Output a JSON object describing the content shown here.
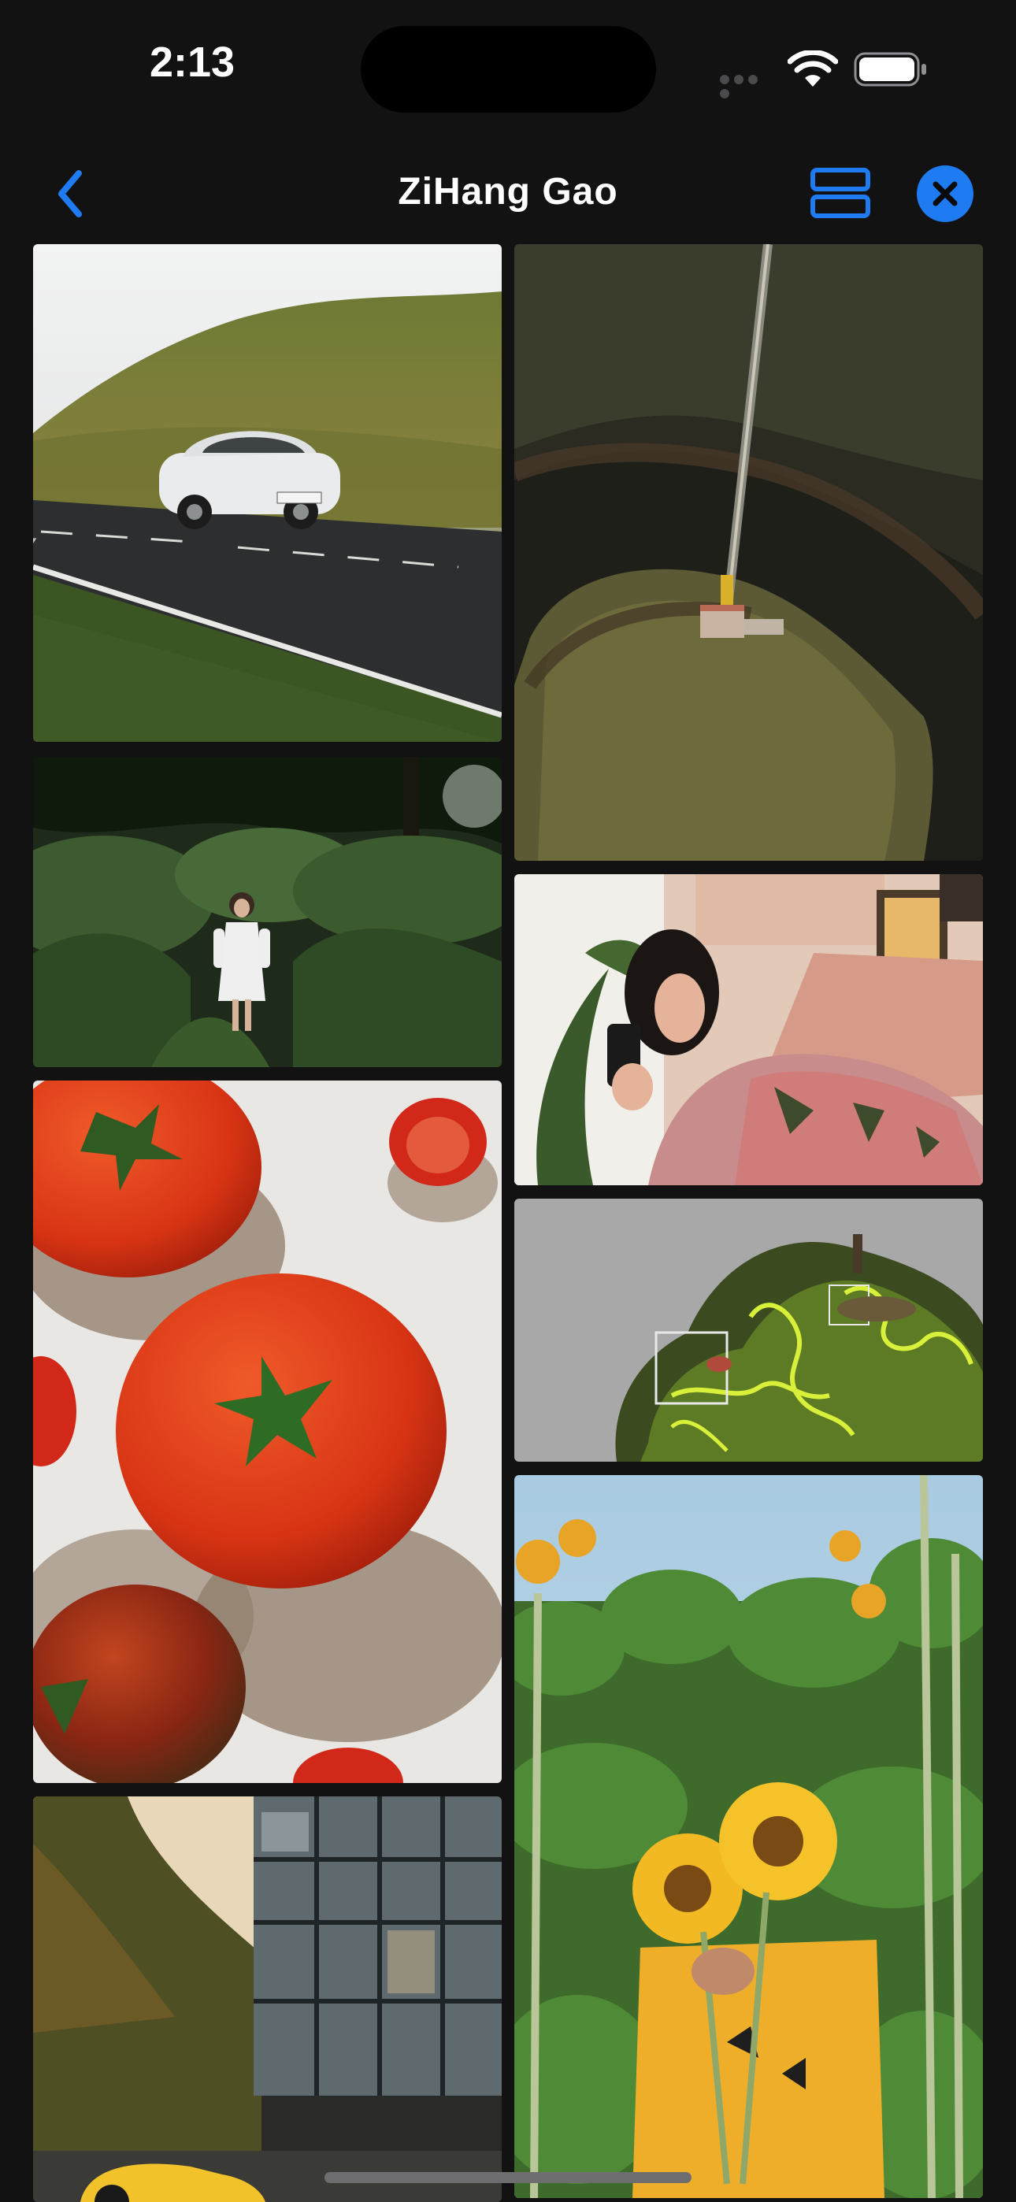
{
  "status_bar": {
    "time": "2:13"
  },
  "nav": {
    "title": "ZiHang Gao",
    "back_icon": "chevron-left-icon",
    "layout_icon": "rows-layout-icon",
    "close_icon": "close-icon"
  },
  "colors": {
    "background": "#121213",
    "accent": "#1f7bf2",
    "text": "#ffffff"
  },
  "photos": [
    {
      "id": "car-on-road",
      "subject": "white car on a hillside road"
    },
    {
      "id": "aerial-pier",
      "subject": "aerial view of a pier and marsh"
    },
    {
      "id": "woman-in-garden",
      "subject": "woman in white dress among large leaves"
    },
    {
      "id": "woman-on-sofa",
      "subject": "woman with phone on a pink sofa"
    },
    {
      "id": "moss-sculpture",
      "subject": "mossy sculpture with glowing yellow lines"
    },
    {
      "id": "tomatoes",
      "subject": "tomatoes on a light surface"
    },
    {
      "id": "sunflowers",
      "subject": "person holding sunflowers in a field"
    },
    {
      "id": "building-car",
      "subject": "glass building with a yellow sports car"
    }
  ]
}
